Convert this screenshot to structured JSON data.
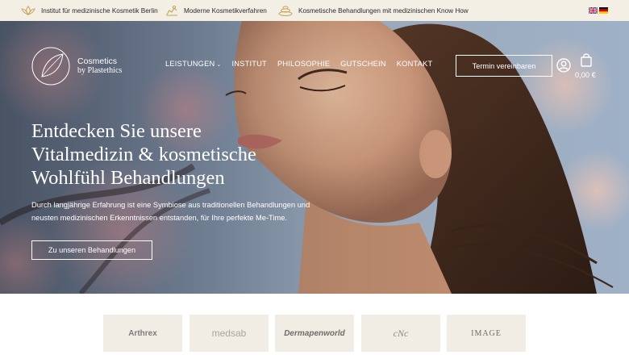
{
  "topbar": {
    "usps": [
      {
        "icon": "lotus-icon",
        "text": "Institut für medizinische Kosmetik Berlin"
      },
      {
        "icon": "hands-icon",
        "text": "Moderne Kosmetikverfahren"
      },
      {
        "icon": "stones-icon",
        "text": "Kosmetische Behandlungen mit medizinischen Know How"
      }
    ],
    "languages": [
      "en-flag-icon",
      "de-flag-icon"
    ]
  },
  "header": {
    "logo_line1": "Cosmetics",
    "logo_line2": "by Plastethics",
    "nav": [
      {
        "label": "LEISTUNGEN",
        "has_dropdown": true
      },
      {
        "label": "INSTITUT"
      },
      {
        "label": "PHILOSOPHIE"
      },
      {
        "label": "GUTSCHEIN"
      },
      {
        "label": "KONTAKT"
      }
    ],
    "cta": "Termin vereinbaren",
    "cart_total": "0,00 €",
    "icons": [
      "user-icon",
      "shopping-bag-icon"
    ]
  },
  "hero": {
    "headline": [
      "Entdecken Sie unsere",
      "Vitalmedizin & kosmetische",
      "Wohlfühl Behandlungen"
    ],
    "subline": [
      "Durch langjährige Erfahrung ist eine Symbiose aus traditionellen Behandlungen und",
      "neusten medizinischen Erkenntnissen entstanden, für Ihre perfekte Me-Time."
    ],
    "cta": "Zu unseren Behandlungen"
  },
  "brands": [
    "Arthrex",
    "medsab",
    "Dermapenworld",
    "cNc",
    "IMAGE"
  ],
  "colors": {
    "topbar_bg": "#f3efe4",
    "brand_tile_bg": "#f1ede4",
    "text_light": "#ffffff"
  }
}
